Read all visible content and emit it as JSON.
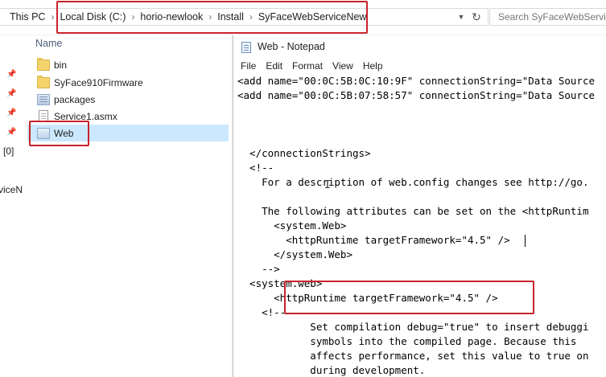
{
  "explorer": {
    "breadcrumb": [
      {
        "label": "This PC"
      },
      {
        "label": "Local Disk (C:)"
      },
      {
        "label": "horio-newlook"
      },
      {
        "label": "Install"
      },
      {
        "label": "SyFaceWebServiceNew"
      }
    ],
    "search_placeholder": "Search SyFaceWebService",
    "nav_fragments": [
      "[0]",
      "viceN"
    ],
    "column_header": "Name",
    "files": [
      {
        "name": "bin",
        "icon": "folder-icon"
      },
      {
        "name": "SyFace910Firmware",
        "icon": "folder-icon"
      },
      {
        "name": "packages",
        "icon": "config-file-icon"
      },
      {
        "name": "Service1.asmx",
        "icon": "text-file-icon"
      },
      {
        "name": "Web",
        "icon": "config-file-icon",
        "selected": true
      }
    ]
  },
  "notepad": {
    "title": "Web - Notepad",
    "menu": [
      "File",
      "Edit",
      "Format",
      "View",
      "Help"
    ],
    "lines": [
      "<add name=\"00:0C:5B:0C:10:9F\" connectionString=\"Data Source",
      "<add name=\"00:0C:5B:07:58:57\" connectionString=\"Data Source",
      "",
      "",
      "  </connectionStrings>",
      "  <!--",
      "    For a description of web.config changes see http://go.",
      "",
      "    The following attributes can be set on the <httpRuntim",
      "      <system.Web>",
      "        <httpRuntime targetFramework=\"4.5\" />",
      "      </system.Web>",
      "    -->",
      "  <system.web>",
      "      <httpRuntime targetFramework=\"4.5\" />",
      "    <!--",
      "            Set compilation debug=\"true\" to insert debuggi",
      "            symbols into the compiled page. Because this",
      "            affects performance, set this value to true on",
      "            during development."
    ]
  },
  "colors": {
    "highlight_box": "#c8232c",
    "selection": "#cce8ff",
    "folder": "#f5d46c"
  }
}
